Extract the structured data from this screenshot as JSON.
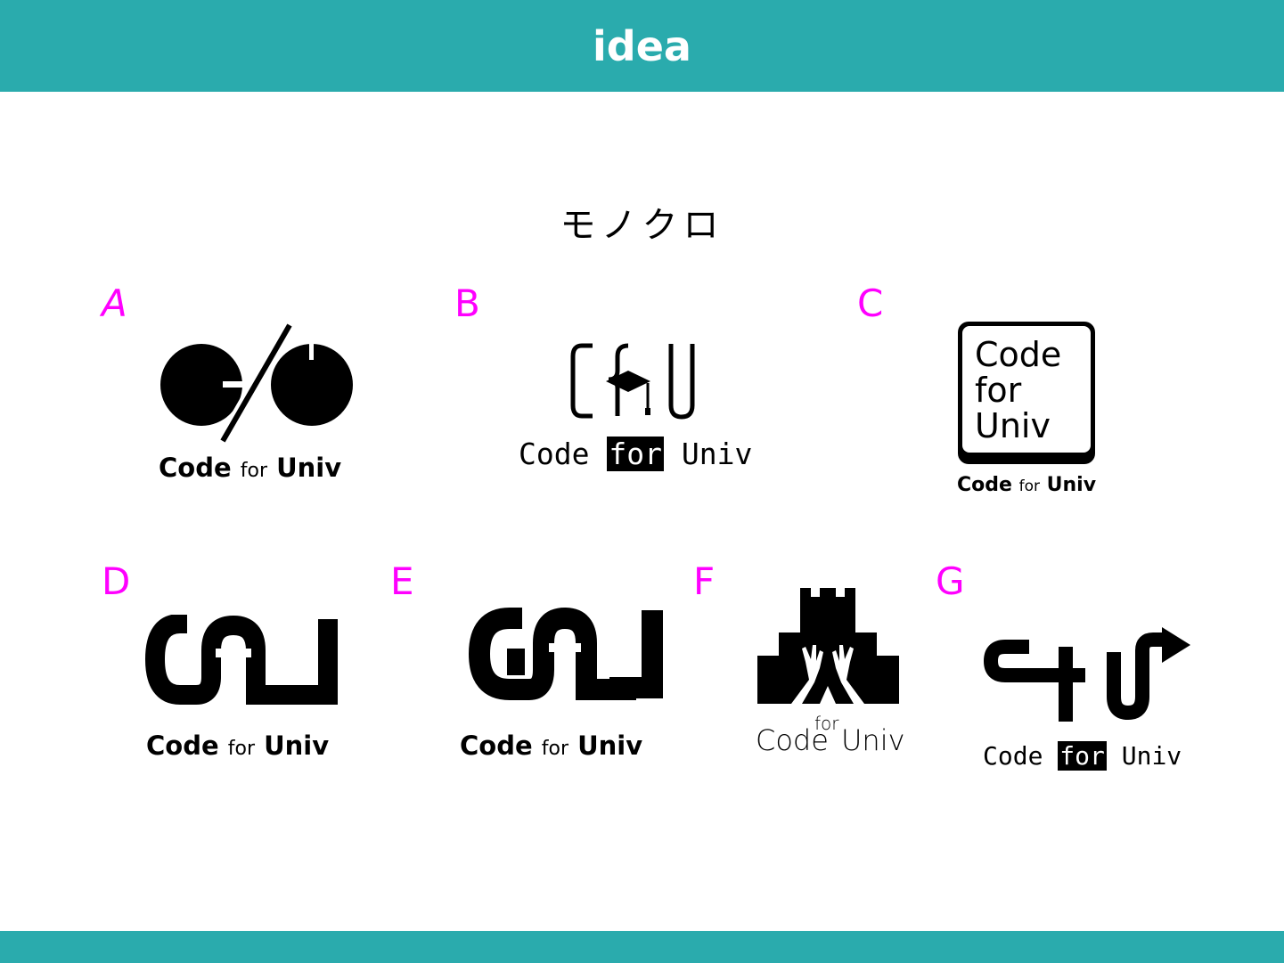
{
  "header": {
    "title": "idea",
    "color": "#2aabad"
  },
  "subtitle": "モノクロ",
  "accent_color": "#ff00ff",
  "logos": [
    {
      "letter": "A",
      "word1": "Code",
      "word2": "for",
      "word3": "Univ"
    },
    {
      "letter": "B",
      "word1": "Code",
      "word2": "for",
      "word3": "Univ"
    },
    {
      "letter": "C",
      "box_line1": "Code",
      "box_line2": "for",
      "box_line3": "Univ",
      "word1": "Code",
      "word2": "for",
      "word3": "Univ"
    },
    {
      "letter": "D",
      "word1": "Code",
      "word2": "for",
      "word3": "Univ"
    },
    {
      "letter": "E",
      "word1": "Code",
      "word2": "for",
      "word3": "Univ"
    },
    {
      "letter": "F",
      "word1": "Code",
      "word2": "for",
      "word3": "Univ"
    },
    {
      "letter": "G",
      "word1": "Code",
      "word2": "for",
      "word3": "Univ"
    }
  ]
}
